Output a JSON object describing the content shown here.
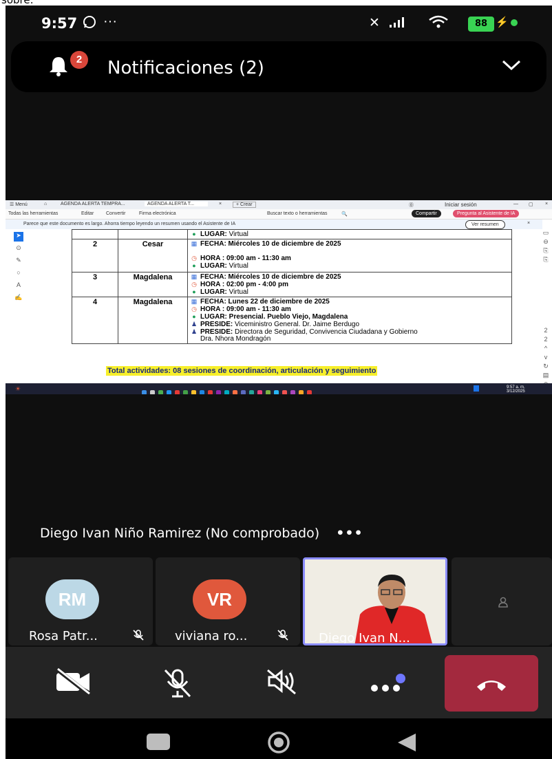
{
  "top_crop_text": "sobre:",
  "status_bar": {
    "time": "9:57",
    "more": "···",
    "battery": "88"
  },
  "notification": {
    "badge_count": "2",
    "title": "Notificaciones (2)"
  },
  "shared_screen": {
    "browser": {
      "menu": "☰ Menú",
      "tab1": "AGENDA ALERTA TEMPRA...",
      "tab2": "AGENDA ALERTA T...",
      "tab_close": "×",
      "new_tab": "+ Crear",
      "sign_in": "Iniciar sesión"
    },
    "toolbar": {
      "all_tools": "Todas las herramientas",
      "edit": "Editar",
      "convert": "Convertir",
      "esign": "Firma electrónica",
      "search": "Buscar texto o herramientas",
      "share": "Compartir",
      "ai_assistant": "Pregunta al Asistente de IA"
    },
    "ai_notice": {
      "text": "Parece que este documento es largo. Ahorra tiempo leyendo un resumen usando el Asistente de IA",
      "view_summary": "Ver resumen"
    },
    "agenda_rows": [
      {
        "num": "",
        "place": "",
        "lines": [
          {
            "icon": "globe",
            "label": "LUGAR:",
            "value": " Virtual"
          }
        ]
      },
      {
        "num": "2",
        "place": "Cesar",
        "lines": [
          {
            "icon": "calendar",
            "label": "FECHA: Miércoles 10 de diciembre de 2025",
            "value": ""
          },
          {
            "icon": "",
            "label": "",
            "value": ""
          },
          {
            "icon": "clock",
            "label": "HORA : 09:00 am - 11:30 am",
            "value": ""
          },
          {
            "icon": "globe",
            "label": "LUGAR:",
            "value": " Virtual"
          }
        ]
      },
      {
        "num": "3",
        "place": "Magdalena",
        "lines": [
          {
            "icon": "calendar",
            "label": "FECHA: Miércoles 10 de diciembre de 2025",
            "value": ""
          },
          {
            "icon": "clock",
            "label": "HORA : 02:00 pm - 4:00 pm",
            "value": ""
          },
          {
            "icon": "globe",
            "label": "LUGAR:",
            "value": " Virtual"
          }
        ]
      },
      {
        "num": "4",
        "place": "Magdalena",
        "lines": [
          {
            "icon": "calendar",
            "label": "FECHA: Lunes 22 de diciembre de 2025",
            "value": ""
          },
          {
            "icon": "clock",
            "label": "HORA : 09:00 am - 11:30 am",
            "value": ""
          },
          {
            "icon": "globe",
            "label": "LUGAR: Presencial. Pueblo Viejo, Magdalena",
            "value": ""
          },
          {
            "icon": "person",
            "label": "PRESIDE:",
            "value": " Viceministro General. Dr. Jaime Berdugo"
          },
          {
            "icon": "person",
            "label": "PRESIDE:",
            "value": " Directora de Seguridad, Convivencia Ciudadana y Gobierno"
          },
          {
            "icon": "",
            "label": "Dra. Nhora Mondragón",
            "value": ""
          }
        ]
      }
    ],
    "total": "Total actividades: 08 sesiones de coordinación, articulación y seguimiento",
    "clock_time": "9:57 a. m.",
    "clock_date": "3/12/2025"
  },
  "active_speaker": {
    "name": "Diego Ivan Niño Ramirez (No comprobado)",
    "more": "•••"
  },
  "participants": [
    {
      "initials": "RM",
      "name": "Rosa Patr...",
      "color": "#bcd8e6",
      "text_color": "#ffffff"
    },
    {
      "initials": "VR",
      "name": "viviana ro...",
      "color": "#e0583c",
      "text_color": "#ffffff"
    },
    {
      "initials": "",
      "name": "Diego Ivan N...",
      "color": "#8b8dff",
      "text_color": "#ffffff"
    }
  ],
  "colors": {
    "end_call": "#a3293e",
    "more_dot": "#6e76ff"
  }
}
